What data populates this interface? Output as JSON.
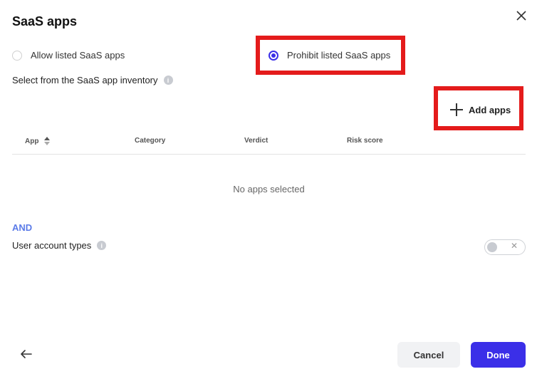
{
  "dialog": {
    "title": "SaaS apps",
    "close_icon": "close-icon"
  },
  "mode": {
    "allow_label": "Allow listed SaaS apps",
    "prohibit_label": "Prohibit listed SaaS apps",
    "selected": "prohibit"
  },
  "inventory": {
    "label": "Select from the SaaS app inventory",
    "info_icon": "info-icon",
    "add_label": "Add apps"
  },
  "table": {
    "columns": [
      "App",
      "Category",
      "Verdict",
      "Risk score"
    ],
    "empty_text": "No apps selected"
  },
  "conditions": {
    "operator": "AND",
    "user_account_label": "User account types",
    "toggle_on": false
  },
  "footer": {
    "back_icon": "arrow-left-icon",
    "cancel_label": "Cancel",
    "done_label": "Done"
  },
  "colors": {
    "primary": "#3b2fe8",
    "highlight": "#e41b1b",
    "and_text": "#5b7be8"
  }
}
